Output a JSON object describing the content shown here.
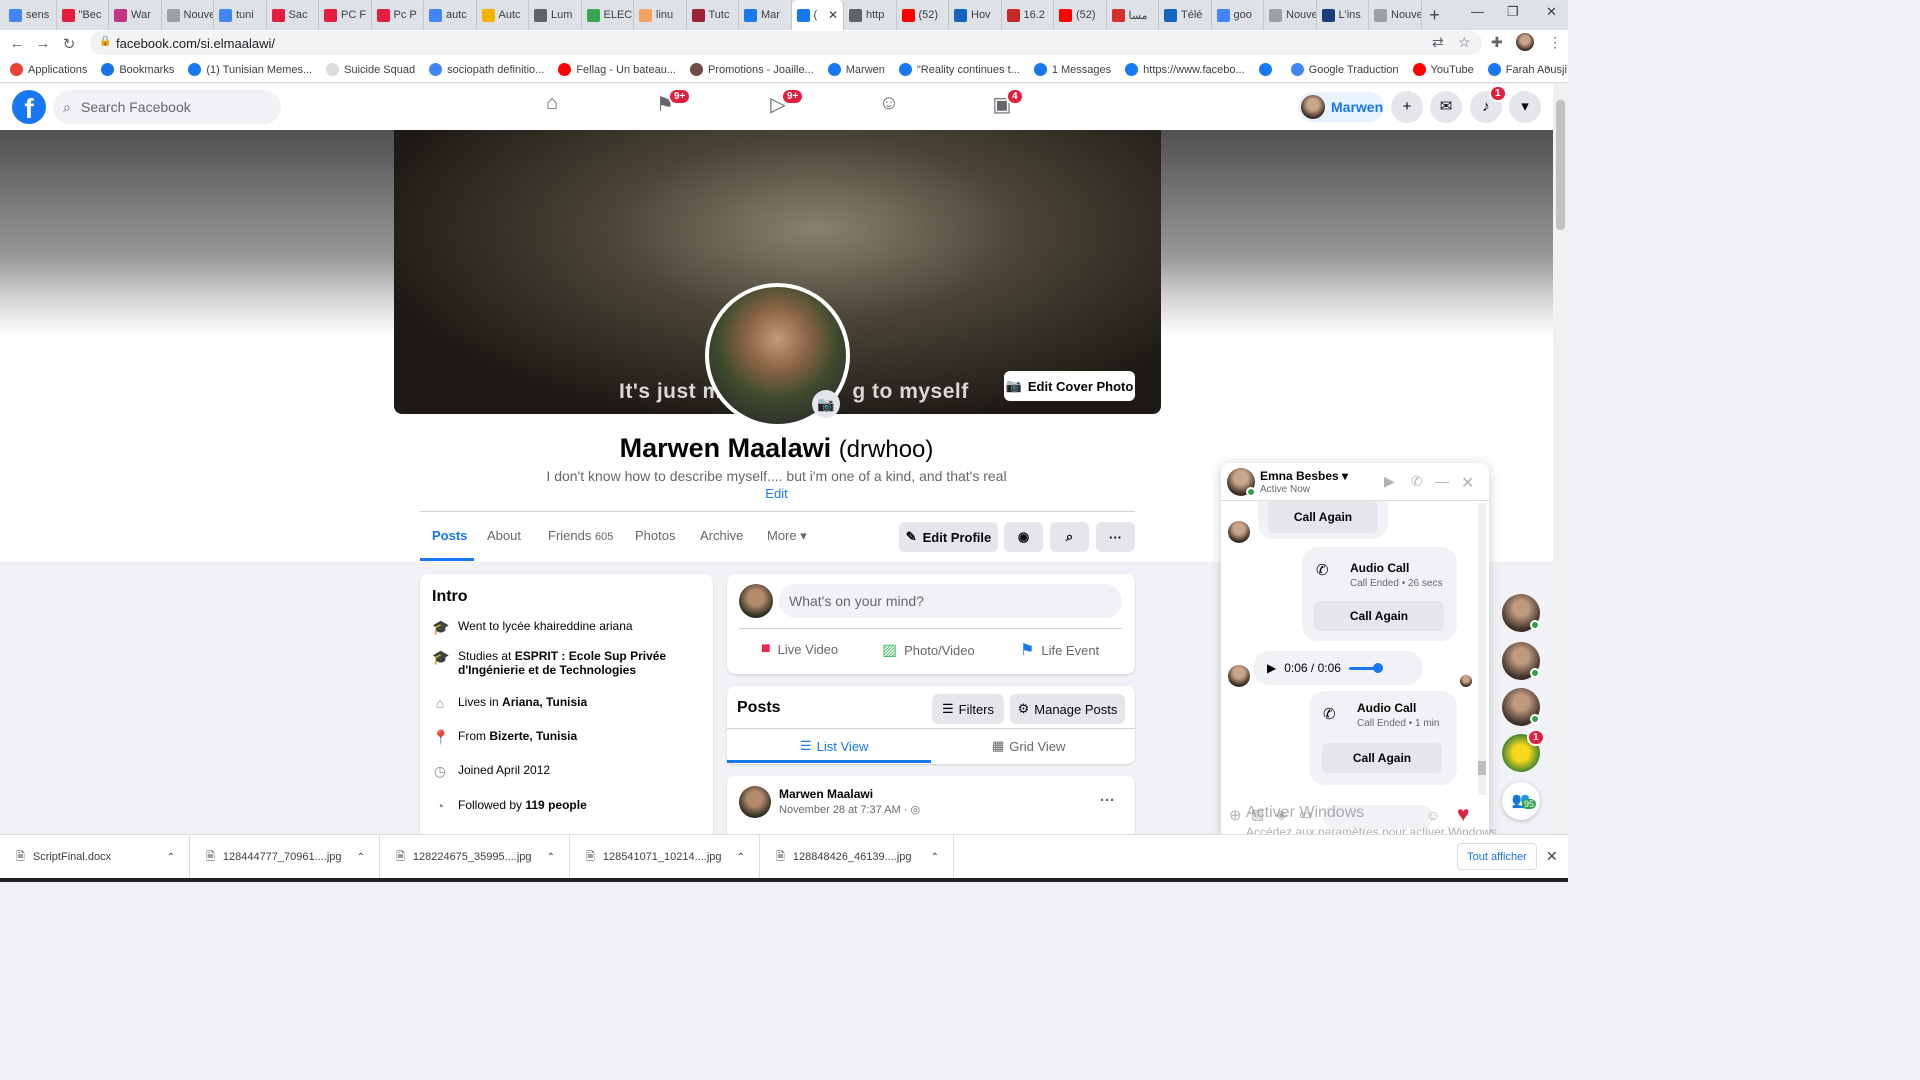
{
  "browser": {
    "tabs": [
      "sens",
      "\"Bec",
      "War",
      "Nouvel c",
      "tuni",
      "Sac",
      "PC F",
      "Pc P",
      "autc",
      "Autc",
      "Lum",
      "ELEC",
      "linu",
      "Tutc",
      "Mar",
      "(",
      "http",
      "(52)",
      "Hov",
      "16.2",
      "(52)",
      "مسا",
      "Télé",
      "goo",
      "Nouvel c",
      "L'ins",
      "Nouvel c"
    ],
    "tab_colors": [
      "#4285f4",
      "#e41e3f",
      "#c13584",
      "#9aa0a6",
      "#4285f4",
      "#e41e3f",
      "#e41e3f",
      "#e41e3f",
      "#4285f4",
      "#f4b400",
      "#5f6368",
      "#34a853",
      "#f4a261",
      "#9b2335",
      "#1877f2",
      "#1877f2",
      "#5f6368",
      "#ff0000",
      "#1565c0",
      "#c62828",
      "#ff0000",
      "#d32f2f",
      "#1565c0",
      "#4285f4",
      "#9aa0a6",
      "#1a3d7c",
      "#9aa0a6"
    ],
    "active_tab_index": 15,
    "new_tab": "+",
    "url": "facebook.com/si.elmaalawi/",
    "bookmarks": [
      {
        "label": "Applications",
        "color": "#ea4335"
      },
      {
        "label": "Bookmarks",
        "color": "#1a73e8"
      },
      {
        "label": "(1) Tunisian Memes...",
        "color": "#1877f2"
      },
      {
        "label": "Suicide Squad",
        "color": "#dadce0"
      },
      {
        "label": "sociopath definitio...",
        "color": "#4285f4"
      },
      {
        "label": "Fellag - Un bateau...",
        "color": "#ff0000"
      },
      {
        "label": "Promotions - Joaille...",
        "color": "#6d4c41"
      },
      {
        "label": "Marwen",
        "color": "#1877f2"
      },
      {
        "label": "\"Reality continues t...",
        "color": "#1877f2"
      },
      {
        "label": "1 Messages",
        "color": "#1877f2"
      },
      {
        "label": "https://www.facebo...",
        "color": "#1877f2"
      },
      {
        "label": "",
        "color": "#1877f2"
      },
      {
        "label": "Google Traduction",
        "color": "#4285f4"
      },
      {
        "label": "YouTube",
        "color": "#ff0000"
      },
      {
        "label": "Farah Aousji",
        "color": "#1877f2"
      }
    ]
  },
  "fb": {
    "search_placeholder": "Search Facebook",
    "badges": {
      "pages": "9+",
      "watch": "9+",
      "gaming": "4",
      "notifications": "1"
    },
    "profile_chip": "Marwen",
    "accent": "#1877f2"
  },
  "profile": {
    "cover_caption_left": "It's just m",
    "cover_caption_right": "g to myself",
    "edit_cover": "Edit Cover Photo",
    "name": "Marwen Maalawi",
    "alt_name": "(drwhoo)",
    "bio": "I don't know how to describe myself.... but i'm one of a kind, and that's real",
    "bio_edit": "Edit",
    "tabs": {
      "posts": "Posts",
      "about": "About",
      "friends": "Friends",
      "friends_count": "605",
      "photos": "Photos",
      "archive": "Archive",
      "more": "More"
    },
    "edit_profile": "Edit Profile"
  },
  "intro": {
    "title": "Intro",
    "went_to": "Went to lycée khaireddine ariana",
    "studies_prefix": "Studies at",
    "studies_school": "ESPRIT : Ecole Sup Privée d'Ingénierie et de Technologies",
    "lives_prefix": "Lives in",
    "lives_place": "Ariana, Tunisia",
    "from_prefix": "From",
    "from_place": "Bizerte, Tunisia",
    "joined": "Joined April 2012",
    "followed_prefix": "Followed by",
    "followed_count": "119 people"
  },
  "composer": {
    "placeholder": "What's on your mind?",
    "live": "Live Video",
    "photo": "Photo/Video",
    "life": "Life Event"
  },
  "posts": {
    "title": "Posts",
    "filters": "Filters",
    "manage": "Manage Posts",
    "list_view": "List View",
    "grid_view": "Grid View",
    "post_author": "Marwen Maalawi",
    "post_time": "November 28 at 7:37 AM ·"
  },
  "chat": {
    "name": "Emna Besbes",
    "status": "Active Now",
    "call_again_1": "Call Again",
    "call1_title": "Audio Call",
    "call1_sub": "Call Ended • 26 secs",
    "call_again_2": "Call Again",
    "audio_time": "0:06 / 0:06",
    "call2_title": "Audio Call",
    "call2_sub": "Call Ended • 1 min",
    "call_again_3": "Call Again",
    "watermark": "Activer Windows",
    "watermark_sub": "Accédez aux paramètres pour activer Windows."
  },
  "contacts": {
    "badge": "1",
    "count": "95"
  },
  "downloads": {
    "files": [
      "ScriptFinal.docx",
      "128444777_70961....jpg",
      "128224675_35995....jpg",
      "128541071_10214....jpg",
      "128848426_46139....jpg"
    ],
    "show_all": "Tout afficher"
  }
}
